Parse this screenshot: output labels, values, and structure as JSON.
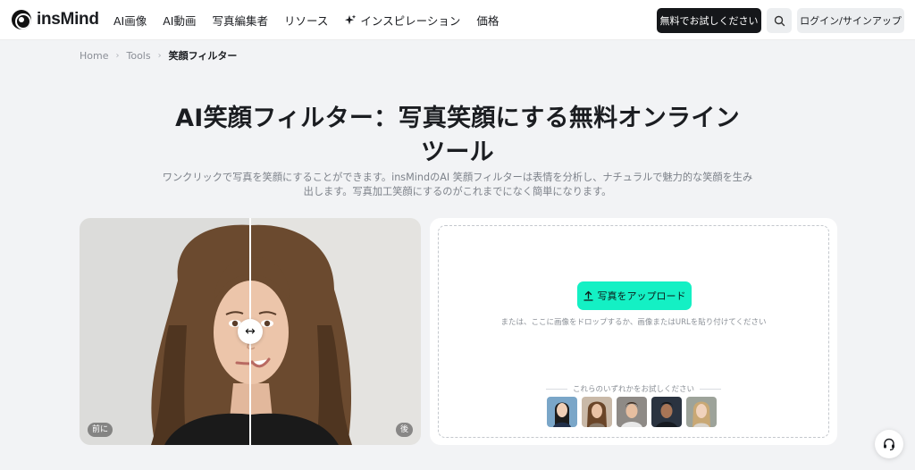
{
  "header": {
    "logo_text": "insMind",
    "nav": [
      {
        "label": "AI画像"
      },
      {
        "label": "AI動画"
      },
      {
        "label": "写真編集者"
      },
      {
        "label": "リソース"
      },
      {
        "label": "インスピレーション",
        "icon": "sparkle-icon"
      },
      {
        "label": "価格"
      }
    ],
    "trial_button": "無料でお試しください",
    "search_icon": "search-icon",
    "login_button": "ログイン/サインアップ"
  },
  "breadcrumb": [
    "Home",
    "Tools",
    "笑顔フィルター"
  ],
  "hero": {
    "title_line1": "AI笑顔フィルター：写真笑顔にする無料オンライン",
    "title_line2": "ツール",
    "subtitle_line1": "ワンクリックで写真を笑顔にすることができます。insMindのAI 笑顔フィルターは表情を分析し、ナチュラルで魅力的な笑顔を生み",
    "subtitle_line2": "出します。写真加工笑顔にするのがこれまでになく簡単になります。"
  },
  "compare": {
    "before_label": "前に",
    "after_label": "後",
    "handle_glyph": "↔"
  },
  "upload": {
    "button_label": "写真をアップロード",
    "drop_hint": "または、ここに画像をドロップするか、画像またはURLを貼り付けてください",
    "try_label": "これらのいずれかをお試しください",
    "samples": [
      "sample-1",
      "sample-2",
      "sample-3",
      "sample-4",
      "sample-5"
    ]
  },
  "colors": {
    "accent": "#14f0c4",
    "dark_button": "#15171a",
    "background": "#f2f3f5"
  }
}
